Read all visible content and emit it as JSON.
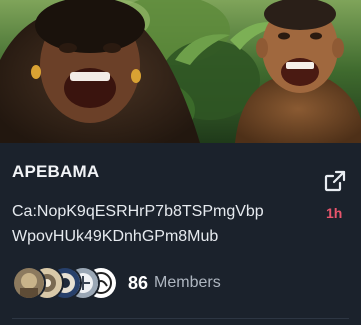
{
  "community": {
    "title": "APEBAMA",
    "contract_line1": "Ca:NopK9qESRHrP7b8TSPmgVbp",
    "contract_line2": "WpovHUk49KDnhGPm8Mub",
    "time_ago": "1h",
    "member_count": "86",
    "member_label": "Members"
  },
  "icons": {
    "open": "external-link-icon"
  },
  "colors": {
    "background": "#1b222c",
    "time_accent": "#e8556c",
    "muted_text": "#aeb6c0"
  }
}
